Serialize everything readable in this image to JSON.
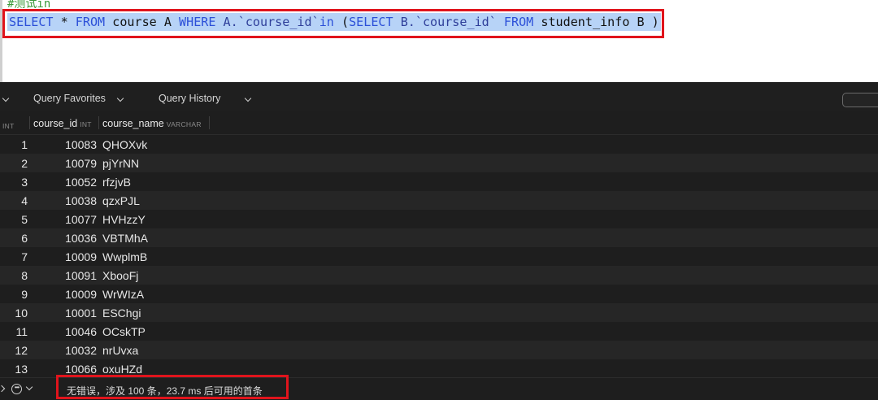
{
  "editor": {
    "comment": "#测试in",
    "query": {
      "select": "SELECT",
      "star": " * ",
      "from": "FROM",
      "table_a": " course A ",
      "where": "WHERE",
      "a_col": " A.`course_id`",
      "in": "in",
      "open": " (",
      "select2": "SELECT",
      "b_col": " B.`course_id` ",
      "from2": "FROM",
      "table_b": " student_info B )"
    }
  },
  "toolbar": {
    "favorites_label": "Query Favorites",
    "history_label": "Query History"
  },
  "grid": {
    "index_type": "INT",
    "columns": [
      {
        "name": "course_id",
        "type": "INT"
      },
      {
        "name": "course_name",
        "type": "VARCHAR"
      }
    ],
    "rows": [
      {
        "num": "1",
        "course_id": "10083",
        "course_name": "QHOXvk"
      },
      {
        "num": "2",
        "course_id": "10079",
        "course_name": "pjYrNN"
      },
      {
        "num": "3",
        "course_id": "10052",
        "course_name": "rfzjvB"
      },
      {
        "num": "4",
        "course_id": "10038",
        "course_name": "qzxPJL"
      },
      {
        "num": "5",
        "course_id": "10077",
        "course_name": "HVHzzY"
      },
      {
        "num": "6",
        "course_id": "10036",
        "course_name": "VBTMhA"
      },
      {
        "num": "7",
        "course_id": "10009",
        "course_name": "WwplmB"
      },
      {
        "num": "8",
        "course_id": "10091",
        "course_name": "XbooFj"
      },
      {
        "num": "9",
        "course_id": "10009",
        "course_name": "WrWIzA"
      },
      {
        "num": "10",
        "course_id": "10001",
        "course_name": "ESChgi"
      },
      {
        "num": "11",
        "course_id": "10046",
        "course_name": "OCskTP"
      },
      {
        "num": "12",
        "course_id": "10032",
        "course_name": "nrUvxa"
      },
      {
        "num": "13",
        "course_id": "10066",
        "course_name": "oxuHZd"
      }
    ]
  },
  "status": {
    "message": "无错误，涉及 100 条，23.7 ms 后可用的首条"
  },
  "colors": {
    "highlight_border": "#e0141c",
    "sql_keyword": "#2b4fd8",
    "selection": "#b7d3f7"
  }
}
